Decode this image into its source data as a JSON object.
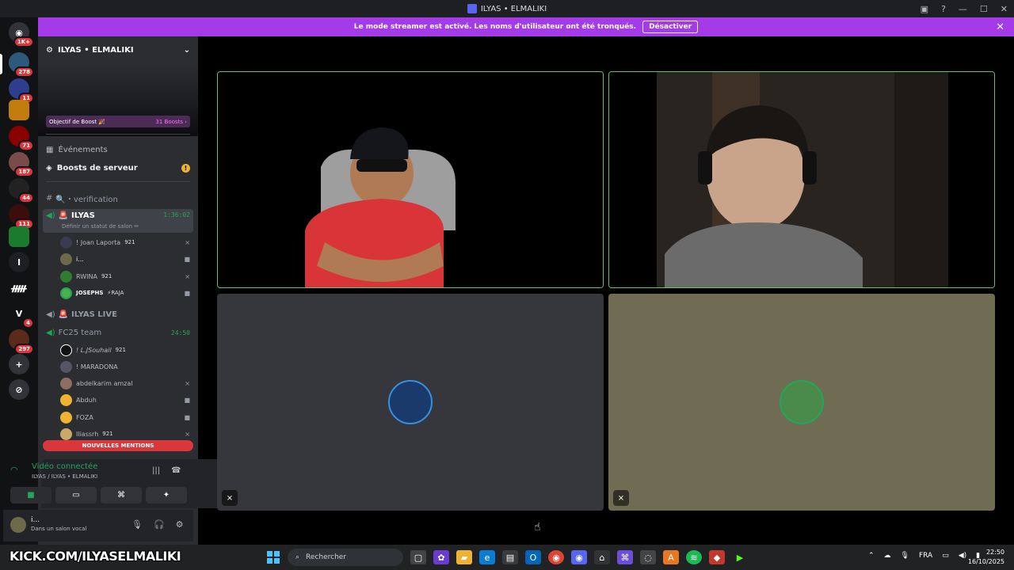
{
  "window": {
    "title": "ILYAS • ELMALIKI"
  },
  "banner": {
    "message": "Le mode streamer est activé. Les noms d'utilisateur ont été tronqués.",
    "button": "Désactiver"
  },
  "rail": {
    "home_badge": "1K+",
    "servers": [
      {
        "badge": "278"
      },
      {
        "badge": "11"
      },
      {
        "badge": ""
      },
      {
        "badge": "71"
      },
      {
        "badge": "187"
      },
      {
        "badge": "44"
      },
      {
        "badge": "111"
      },
      {
        "badge": ""
      },
      {
        "label": "I",
        "badge": ""
      },
      {
        "label": "ᚏ",
        "badge": ""
      },
      {
        "label": "V",
        "badge": "4"
      },
      {
        "badge": "297"
      }
    ]
  },
  "sidebar": {
    "guild_name": "ILYAS • ELMALIKI",
    "boost": {
      "label": "Objectif de Boost 🎉",
      "count": "31 Boosts ›"
    },
    "events": "Événements",
    "server_boosts": "Boosts de serveur",
    "channels": {
      "verification": "🔍・verification",
      "voice1": {
        "name": "ILYAS",
        "time": "1:36:02",
        "status": "Définir un statut de salon ✏"
      },
      "voice1_users": [
        {
          "name": "! Joan Laporta",
          "tag": "921"
        },
        {
          "name": "i...",
          "tag": ""
        },
        {
          "name": "RWINA",
          "tag": "921"
        },
        {
          "name": "JOSEPHS",
          "tag": "⚡RAJA"
        }
      ],
      "voice2": {
        "name": "ILYAS LIVE"
      },
      "voice3": {
        "name": "FC25 team",
        "time": "24:50"
      },
      "voice3_users": [
        {
          "name": "! L.JSouhail",
          "tag": "921"
        },
        {
          "name": "! MARADONA",
          "tag": ""
        },
        {
          "name": "abdelkarim amzal",
          "tag": ""
        },
        {
          "name": "Abduh",
          "tag": ""
        },
        {
          "name": "FOZA",
          "tag": ""
        },
        {
          "name": "Iliassrh",
          "tag": "921"
        }
      ]
    },
    "mentions": "NOUVELLES MENTIONS"
  },
  "voice_panel": {
    "status": "Vidéo connectée",
    "channel": "ILYAS / ILYAS • ELMALIKI"
  },
  "user_panel": {
    "name": "i...",
    "status": "Dans un salon vocal"
  },
  "taskbar": {
    "kick": "KICK.COM/ILYASELMALIKI",
    "search": "Rechercher",
    "lang": "FRA",
    "time": "22:50",
    "date": "16/10/2025"
  },
  "colors": {
    "accent": "#5865f2",
    "banner": "#a43ae8",
    "speaking": "#23a55a",
    "mentions": "#da373c"
  }
}
